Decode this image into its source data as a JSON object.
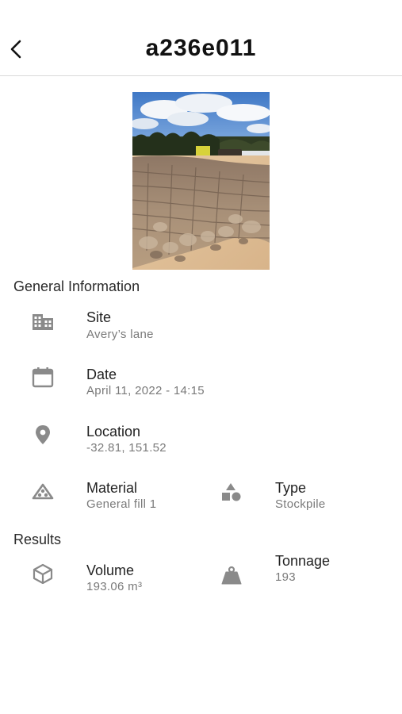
{
  "header": {
    "title": "a236e011",
    "back_icon": "chevron-left-icon"
  },
  "photo": {
    "subject": "stockpile-photo"
  },
  "general_information": {
    "title": "General Information",
    "site": {
      "label": "Site",
      "value": "Avery’s lane",
      "icon": "building-icon"
    },
    "date": {
      "label": "Date",
      "value": "April 11, 2022 - 14:15",
      "icon": "calendar-icon"
    },
    "location": {
      "label": "Location",
      "value": "-32.81, 151.52",
      "icon": "map-pin-icon"
    },
    "material": {
      "label": "Material",
      "value": "General fill 1",
      "icon": "material-pile-icon"
    },
    "type": {
      "label": "Type",
      "value": "Stockpile",
      "icon": "shapes-icon"
    }
  },
  "results": {
    "title": "Results",
    "volume": {
      "label": "Volume",
      "value": "193.06 m³",
      "icon": "cube-icon"
    },
    "tonnage": {
      "label": "Tonnage",
      "value": "193",
      "icon": "weight-icon"
    }
  },
  "colors": {
    "icon": "#8a8a8a",
    "label": "#222222",
    "value": "#7a7a7a",
    "divider": "#d9d9d9"
  }
}
